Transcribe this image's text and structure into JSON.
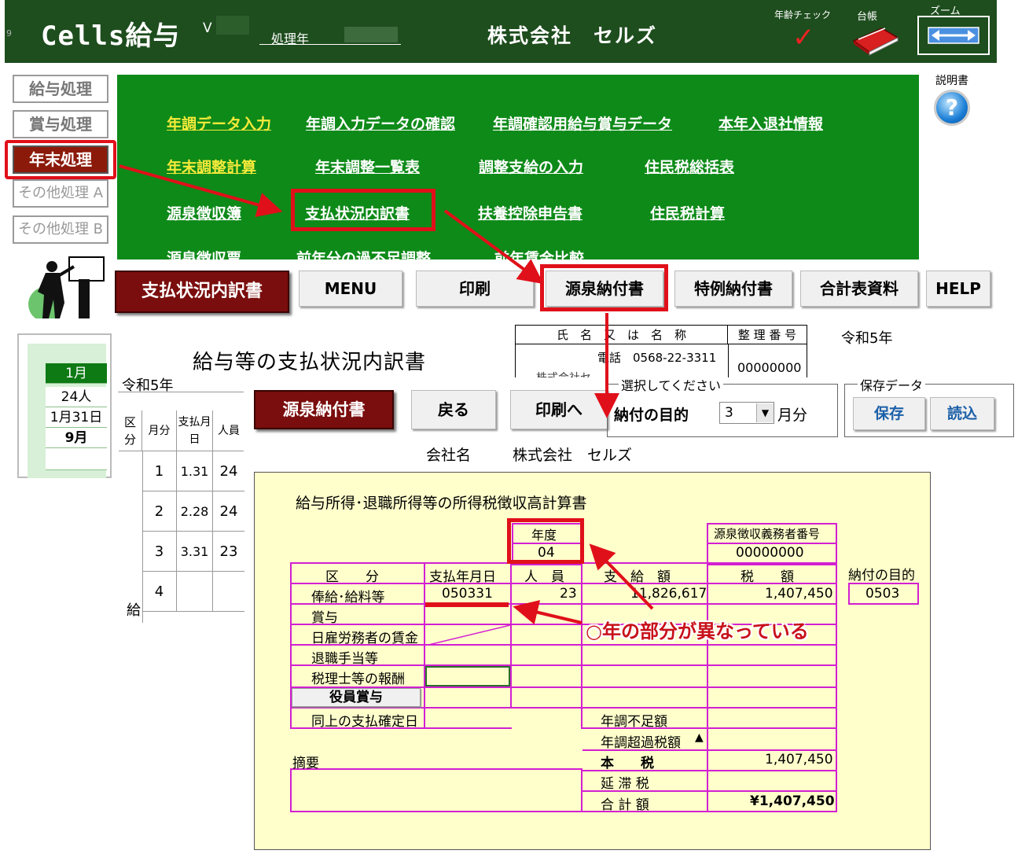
{
  "header": {
    "app_title": "Cells給与",
    "left_digit": "9",
    "version_label": "V",
    "year_label": "処理年",
    "company": "株式会社　セルズ",
    "age_check": "年齢チェック",
    "ledger": "台帳",
    "zoom": "ズーム"
  },
  "nav": {
    "items": [
      "給与処理",
      "賞与処理",
      "年末処理",
      "その他処理 A",
      "その他処理 B"
    ]
  },
  "menu": {
    "links": [
      "年調データ入力",
      "年調入力データの確認",
      "年調確認用給与賞与データ",
      "本年入退社情報",
      "年末調整計算",
      "年末調整一覧表",
      "調整支給の入力",
      "住民税総括表",
      "源泉徴収簿",
      "支払状況内訳書",
      "扶養控除申告書",
      "住民税計算",
      "源泉徴収票",
      "前年分の過不足調整",
      "前年賃金比較"
    ]
  },
  "help_label": "説明書",
  "toolbar1": {
    "title": "支払状況内訳書",
    "buttons": [
      "MENU",
      "印刷",
      "源泉納付書",
      "特例納付書",
      "合計表資料",
      "HELP"
    ]
  },
  "doc": {
    "title": "給与等の支払状況内訳書",
    "reiwa": "令和5年",
    "reiwa_right": "令和5年",
    "name_header": [
      "氏　名　又　は　名　称",
      "整 理 番 号"
    ],
    "phone": "電話　0568-22-3311",
    "reg_no": "00000000",
    "truncated": "株式会社セ",
    "mini_headers": [
      "区分",
      "月分",
      "支払月日",
      "人員"
    ],
    "mini_rows": [
      [
        "1",
        "1.31",
        "24"
      ],
      [
        "2",
        "2.28",
        "24"
      ],
      [
        "3",
        "3.31",
        "23"
      ],
      [
        "4",
        "",
        ""
      ]
    ],
    "mini_side": "給"
  },
  "left_sheet": {
    "cells": [
      "1月",
      "24人",
      "1月31日",
      "9月"
    ]
  },
  "toolbar2": {
    "title": "源泉納付書",
    "back": "戻る",
    "print": "印刷へ",
    "select_group": "選択してください",
    "purpose_label": "納付の目的",
    "purpose_value": "3",
    "month_suffix": "月分",
    "save_group": "保存データ",
    "save": "保存",
    "load": "読込",
    "company_label": "会社名",
    "company_value": "株式会社　セルズ"
  },
  "form": {
    "title": "給与所得･退職所得等の所得税徴収高計算書",
    "nendo_label": "年度",
    "nendo_value": "04",
    "obligor_label": "源泉徴収義務者番号",
    "obligor_value": "00000000",
    "col_kubun": "区　　分",
    "col_date": "支払年月日",
    "col_people": "人　員",
    "col_amount": "支　給　額",
    "col_tax": "税　　額",
    "purpose_label": "納付の目的",
    "purpose_value": "0503",
    "rows": [
      "俸給･給料等",
      "賞与",
      "日雇労務者の賃金",
      "退職手当等",
      "税理士等の報酬"
    ],
    "row1_date": "050331",
    "row1_people": "23",
    "row1_amount": "11,826,617",
    "row1_tax": "1,407,450",
    "officer_bonus_btn": "役員賞与",
    "confirm_date": "同上の支払確定日",
    "shortage": "年調不足額",
    "excess": "年調超過税額",
    "triangle": "▲",
    "honzei": "本　　税",
    "honzei_value": "1,407,450",
    "entaizei": "延 滞 税",
    "total": "合 計 額",
    "total_value": "¥1,407,450",
    "remarks": "摘要"
  },
  "annotation": "○年の部分が異なっている",
  "colors": {
    "header_bg": "#1e4d1e",
    "menu_bg": "#0e8a19",
    "highlight": "#e0101a",
    "form_bg": "#ffffcc",
    "form_border": "#d21fd2",
    "title_label_bg": "#7a0d0d"
  }
}
